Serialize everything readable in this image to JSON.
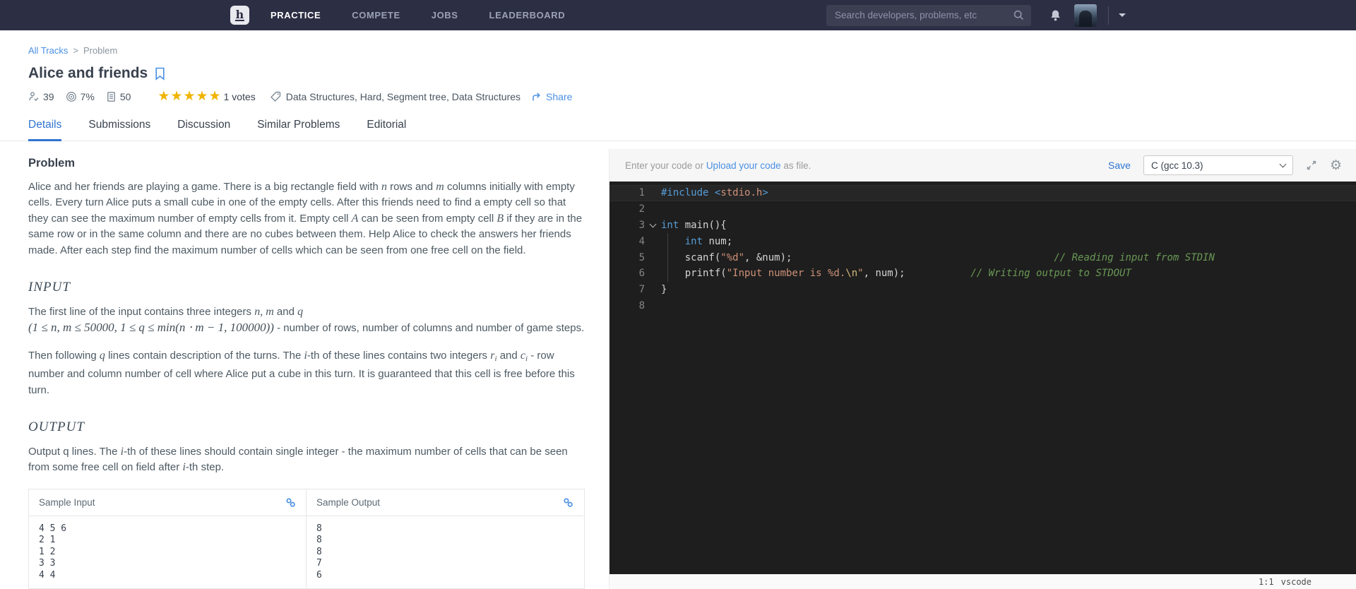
{
  "navbar": {
    "brand": "h",
    "items": [
      {
        "label": "PRACTICE",
        "active": true
      },
      {
        "label": "COMPETE",
        "active": false
      },
      {
        "label": "JOBS",
        "active": false
      },
      {
        "label": "LEADERBOARD",
        "active": false
      }
    ],
    "search_placeholder": "Search developers, problems, etc"
  },
  "breadcrumb": {
    "link": "All Tracks",
    "separator": ">",
    "current": "Problem"
  },
  "problem": {
    "title": "Alice and friends",
    "stats": {
      "attempts": "39",
      "success_rate": "7%",
      "max_score": "50",
      "star_count": 5,
      "votes_label": "1 votes",
      "tags": "Data Structures, Hard, Segment tree, Data Structures",
      "share_label": "Share"
    }
  },
  "tabs": [
    "Details",
    "Submissions",
    "Discussion",
    "Similar Problems",
    "Editorial"
  ],
  "active_tab": 0,
  "content": {
    "heading": "Problem",
    "p1": [
      {
        "t": "Alice and her friends are playing a game. There is a big rectangle field with "
      },
      {
        "t": "n",
        "s": "v"
      },
      {
        "t": " rows and "
      },
      {
        "t": "m",
        "s": "v"
      },
      {
        "t": " columns initially with empty cells. Every turn Alice puts a small cube in one of the empty cells. After this friends need to find a empty cell so that they can see the maximum number of empty cells from it. Empty cell "
      },
      {
        "t": "A",
        "s": "v"
      },
      {
        "t": " can be seen from empty cell "
      },
      {
        "t": "B",
        "s": "v"
      },
      {
        "t": " if they are in the same row or in the same column and there are no cubes between them. Help Alice to check the answers her friends made. After each step find the maximum number of cells which can be seen from one free cell on the field."
      }
    ],
    "input_heading": "INPUT",
    "p2": [
      {
        "t": "The first line of the input contains three integers "
      },
      {
        "t": "n, m",
        "s": "v"
      },
      {
        "t": " and "
      },
      {
        "t": "q",
        "s": "v"
      },
      {
        "s": "br"
      },
      {
        "t": "(1 ≤ n, m ≤ 50000, 1 ≤ q ≤ min(n ⋅ m − 1, 100000))",
        "s": "math"
      },
      {
        "t": " - number of rows, number of columns and number of game steps."
      }
    ],
    "p3": [
      {
        "t": "Then following "
      },
      {
        "t": "q",
        "s": "v"
      },
      {
        "t": " lines contain description of the turns. The "
      },
      {
        "t": "i",
        "s": "v"
      },
      {
        "t": "-th of these lines contains two integers "
      },
      {
        "t": "r",
        "s": "v"
      },
      {
        "t": "i",
        "s": "sub"
      },
      {
        "t": " and "
      },
      {
        "t": "c",
        "s": "v"
      },
      {
        "t": "i",
        "s": "sub"
      },
      {
        "t": " - row number and column number of cell where Alice put a cube in this turn. It is guaranteed that this cell is free before this turn."
      }
    ],
    "output_heading": "OUTPUT",
    "p4": [
      {
        "t": "Output q lines. The "
      },
      {
        "t": "i",
        "s": "v"
      },
      {
        "t": "-th of these lines should contain single integer - the maximum number of cells that can be seen from some free cell on field after "
      },
      {
        "t": "i",
        "s": "v"
      },
      {
        "t": "-th step."
      }
    ]
  },
  "samples": {
    "input_header": "Sample Input",
    "output_header": "Sample Output",
    "input_lines": [
      "4 5 6",
      "2 1",
      "1 2",
      "3 3",
      "4 4"
    ],
    "output_lines": [
      "8",
      "8",
      "8",
      "7",
      "6"
    ]
  },
  "editor": {
    "hint_prefix": "Enter your code or ",
    "hint_link": "Upload your code",
    "hint_suffix": " as file.",
    "save_label": "Save",
    "language": "C (gcc 10.3)",
    "cursor_pos": "1:1",
    "mode": "vscode",
    "lines": [
      {
        "num": 1,
        "current": true,
        "fold": false,
        "tokens": [
          {
            "t": "#include",
            "c": "kw"
          },
          {
            "t": " ",
            "c": "pln"
          },
          {
            "t": "<",
            "c": "kw"
          },
          {
            "t": "stdio.h",
            "c": "str"
          },
          {
            "t": ">",
            "c": "kw"
          }
        ]
      },
      {
        "num": 2,
        "fold": false,
        "tokens": []
      },
      {
        "num": 3,
        "fold": true,
        "tokens": [
          {
            "t": "int",
            "c": "kw"
          },
          {
            "t": " main(){",
            "c": "pln"
          }
        ]
      },
      {
        "num": 4,
        "fold": false,
        "tokens": [
          {
            "t": "    ",
            "c": "pln"
          },
          {
            "t": "int",
            "c": "kw"
          },
          {
            "t": " num;",
            "c": "pln"
          }
        ]
      },
      {
        "num": 5,
        "fold": false,
        "tokens": [
          {
            "t": "    scanf(",
            "c": "pln"
          },
          {
            "t": "\"%d\"",
            "c": "str"
          },
          {
            "t": ", &num);",
            "c": "pln"
          },
          {
            "t": "                                            ",
            "c": "pln"
          },
          {
            "t": "// Reading input from STDIN",
            "c": "cmt"
          }
        ]
      },
      {
        "num": 6,
        "fold": false,
        "tokens": [
          {
            "t": "    printf(",
            "c": "pln"
          },
          {
            "t": "\"Input number is %d.",
            "c": "str"
          },
          {
            "t": "\\n",
            "c": "esc"
          },
          {
            "t": "\"",
            "c": "str"
          },
          {
            "t": ", num);",
            "c": "pln"
          },
          {
            "t": "           ",
            "c": "pln"
          },
          {
            "t": "// Writing output to STDOUT",
            "c": "cmt"
          }
        ]
      },
      {
        "num": 7,
        "fold": false,
        "tokens": [
          {
            "t": "}",
            "c": "pln"
          }
        ]
      },
      {
        "num": 8,
        "fold": false,
        "tokens": []
      }
    ]
  },
  "colors": {
    "navbar_bg": "#2c2e44",
    "link_blue": "#4a90e2",
    "active_tab_blue": "#2f74d0",
    "star_gold": "#f0b400",
    "editor_bg": "#1e1e1e",
    "code_keyword": "#569cd6",
    "code_string": "#ce9178",
    "code_comment": "#6a9955"
  }
}
